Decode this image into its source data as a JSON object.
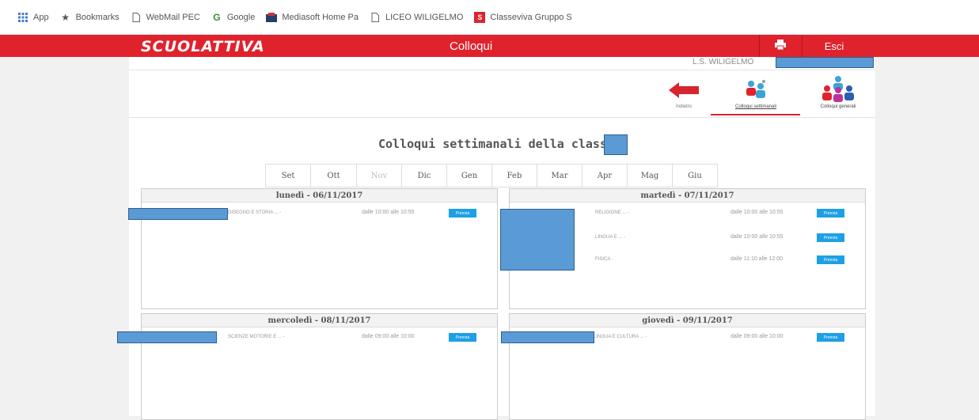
{
  "browser": {
    "bookmarks": [
      {
        "icon": "apps-grid-icon",
        "label": "App"
      },
      {
        "icon": "star-icon",
        "label": "Bookmarks"
      },
      {
        "icon": "page-icon",
        "label": "WebMail PEC"
      },
      {
        "icon": "google-icon",
        "label": "Google"
      },
      {
        "icon": "mediasoft-icon",
        "label": "Mediasoft Home Pa"
      },
      {
        "icon": "page-icon",
        "label": "LICEO WILIGELMO"
      },
      {
        "icon": "classeviva-icon",
        "label": "Classeviva Gruppo S"
      }
    ]
  },
  "header": {
    "logo": "SCUOLATTIVA",
    "title": "Colloqui",
    "print_icon": "printer-icon",
    "logout_label": "Esci",
    "brand_color": "#e0222d"
  },
  "school": {
    "name": "L.S. WILIGELMO"
  },
  "nav": {
    "back_label": "Indietro",
    "weekly_label": "Colloqui settimanali",
    "general_label": "Colloqui generali"
  },
  "page": {
    "heading": "Colloqui settimanali della classe"
  },
  "months": [
    "Set",
    "Ott",
    "Nov",
    "Dic",
    "Gen",
    "Feb",
    "Mar",
    "Apr",
    "Mag",
    "Giu"
  ],
  "selected_month": "Nov",
  "days": [
    {
      "header": "lunedì - 06/11/2017",
      "entries": [
        {
          "subject": "DISEGNO E STORIA ... -",
          "time": "dalle 10:00 alle 10:55",
          "button": "Prenota"
        }
      ]
    },
    {
      "header": "martedì - 07/11/2017",
      "entries": [
        {
          "subject": "RELIGIONE ... -",
          "time": "dalle 10:00 alle 10:55",
          "button": "Prenota"
        },
        {
          "subject": "LINGUA E ... -",
          "time": "dalle 10:00 alle 10:55",
          "button": "Prenota"
        },
        {
          "subject": "FISICA -",
          "time": "dalle 11:10 alle 12:00",
          "button": "Prenota"
        }
      ]
    },
    {
      "header": "mercoledì - 08/11/2017",
      "entries": [
        {
          "subject": "SCIENZE MOTORIE E ... -",
          "time": "dalle 09:00 alle 10:00",
          "button": "Prenota"
        }
      ]
    },
    {
      "header": "giovedì - 09/11/2017",
      "entries": [
        {
          "subject": "LINGUA E CULTURA ... -",
          "time": "dalle 09:00 alle 10:00",
          "button": "Prenota"
        }
      ]
    }
  ]
}
